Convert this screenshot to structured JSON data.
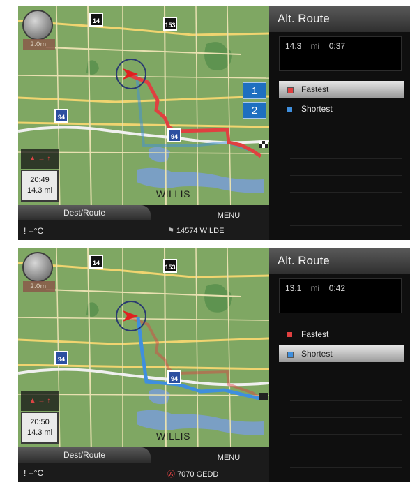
{
  "colors": {
    "fastest": "#e04040",
    "shortest": "#3f8fde",
    "badge": "#1e6fc0",
    "panel": "#0f0f0f",
    "map": "#7fa763"
  },
  "screens": [
    {
      "shields": [
        "14",
        "153",
        "94",
        "94"
      ],
      "time_box": {
        "time": "20:49",
        "distance": "14.3 mi"
      },
      "scale_label": "2.0mi",
      "place": "WILLIS",
      "bottom": {
        "dest_label": "Dest/Route",
        "menu_label": "MENU",
        "temp": "--°C",
        "address": "14574 WILDE"
      },
      "panel": {
        "title": "Alt. Route",
        "distance": "14.3 mi",
        "duration": "0:37",
        "items": [
          {
            "label": "Fastest",
            "selected": true,
            "color": "#e04040",
            "badge": "1"
          },
          {
            "label": "Shortest",
            "selected": false,
            "color": "#3f8fde",
            "badge": "2"
          }
        ]
      }
    },
    {
      "shields": [
        "14",
        "153",
        "94",
        "94"
      ],
      "time_box": {
        "time": "20:50",
        "distance": "14.3 mi"
      },
      "scale_label": "2.0mi",
      "place": "WILLIS",
      "bottom": {
        "dest_label": "Dest/Route",
        "menu_label": "MENU",
        "temp": "--°C",
        "address": "7070 GEDD"
      },
      "panel": {
        "title": "Alt. Route",
        "distance": "13.1 mi",
        "duration": "0:42",
        "items": [
          {
            "label": "Fastest",
            "selected": false,
            "color": "#e04040"
          },
          {
            "label": "Shortest",
            "selected": true,
            "color": "#3f8fde"
          }
        ]
      }
    }
  ]
}
